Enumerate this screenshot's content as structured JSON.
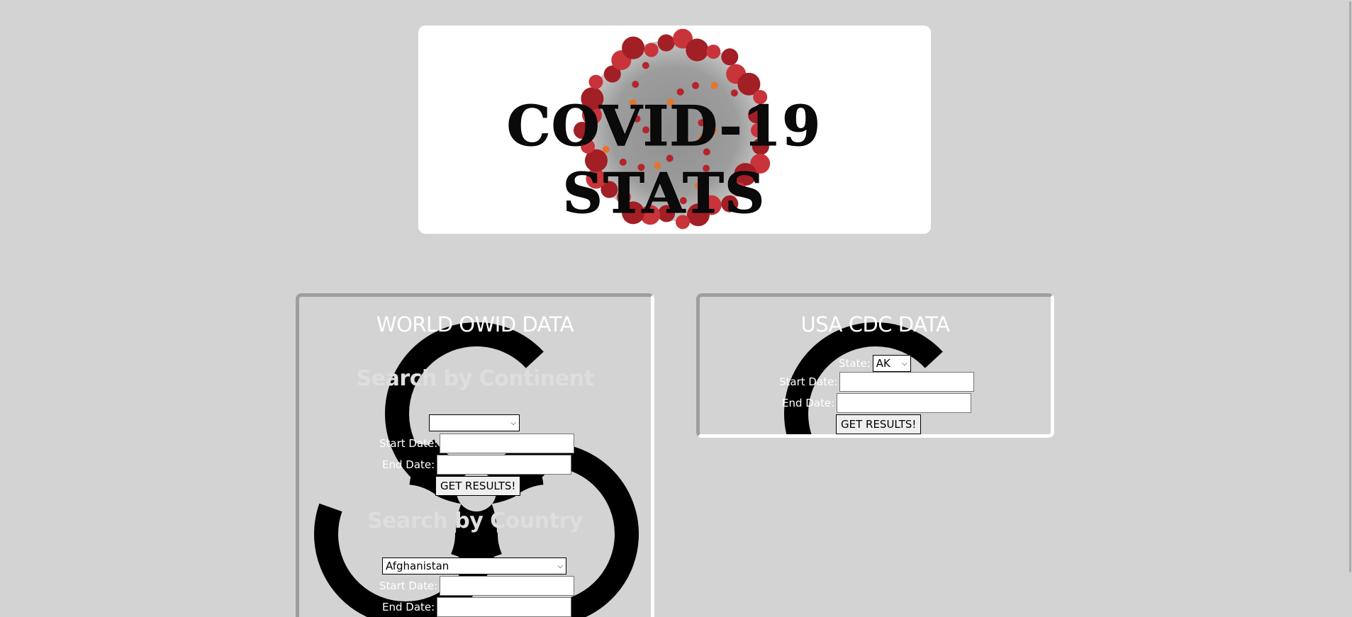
{
  "header": {
    "title_line1": "COVID-19",
    "title_line2": "STATS"
  },
  "world_panel": {
    "title": "WORLD OWID DATA",
    "continent": {
      "heading": "Search by Continent",
      "selected": "",
      "start_label": "Start Date:",
      "end_label": "End Date:",
      "button_label": "GET RESULTS!"
    },
    "country": {
      "heading": "Search by Country",
      "selected": "Afghanistan",
      "start_label": "Start Date:",
      "end_label": "End Date:"
    }
  },
  "usa_panel": {
    "title": "USA CDC DATA",
    "state_label": "State:",
    "state_selected": "AK",
    "start_label": "Start Date:",
    "end_label": "End Date:",
    "button_label": "GET RESULTS!"
  },
  "colors": {
    "background": "#d3d3d3",
    "virus_red": "#b3252b",
    "biohazard": "#000000"
  }
}
